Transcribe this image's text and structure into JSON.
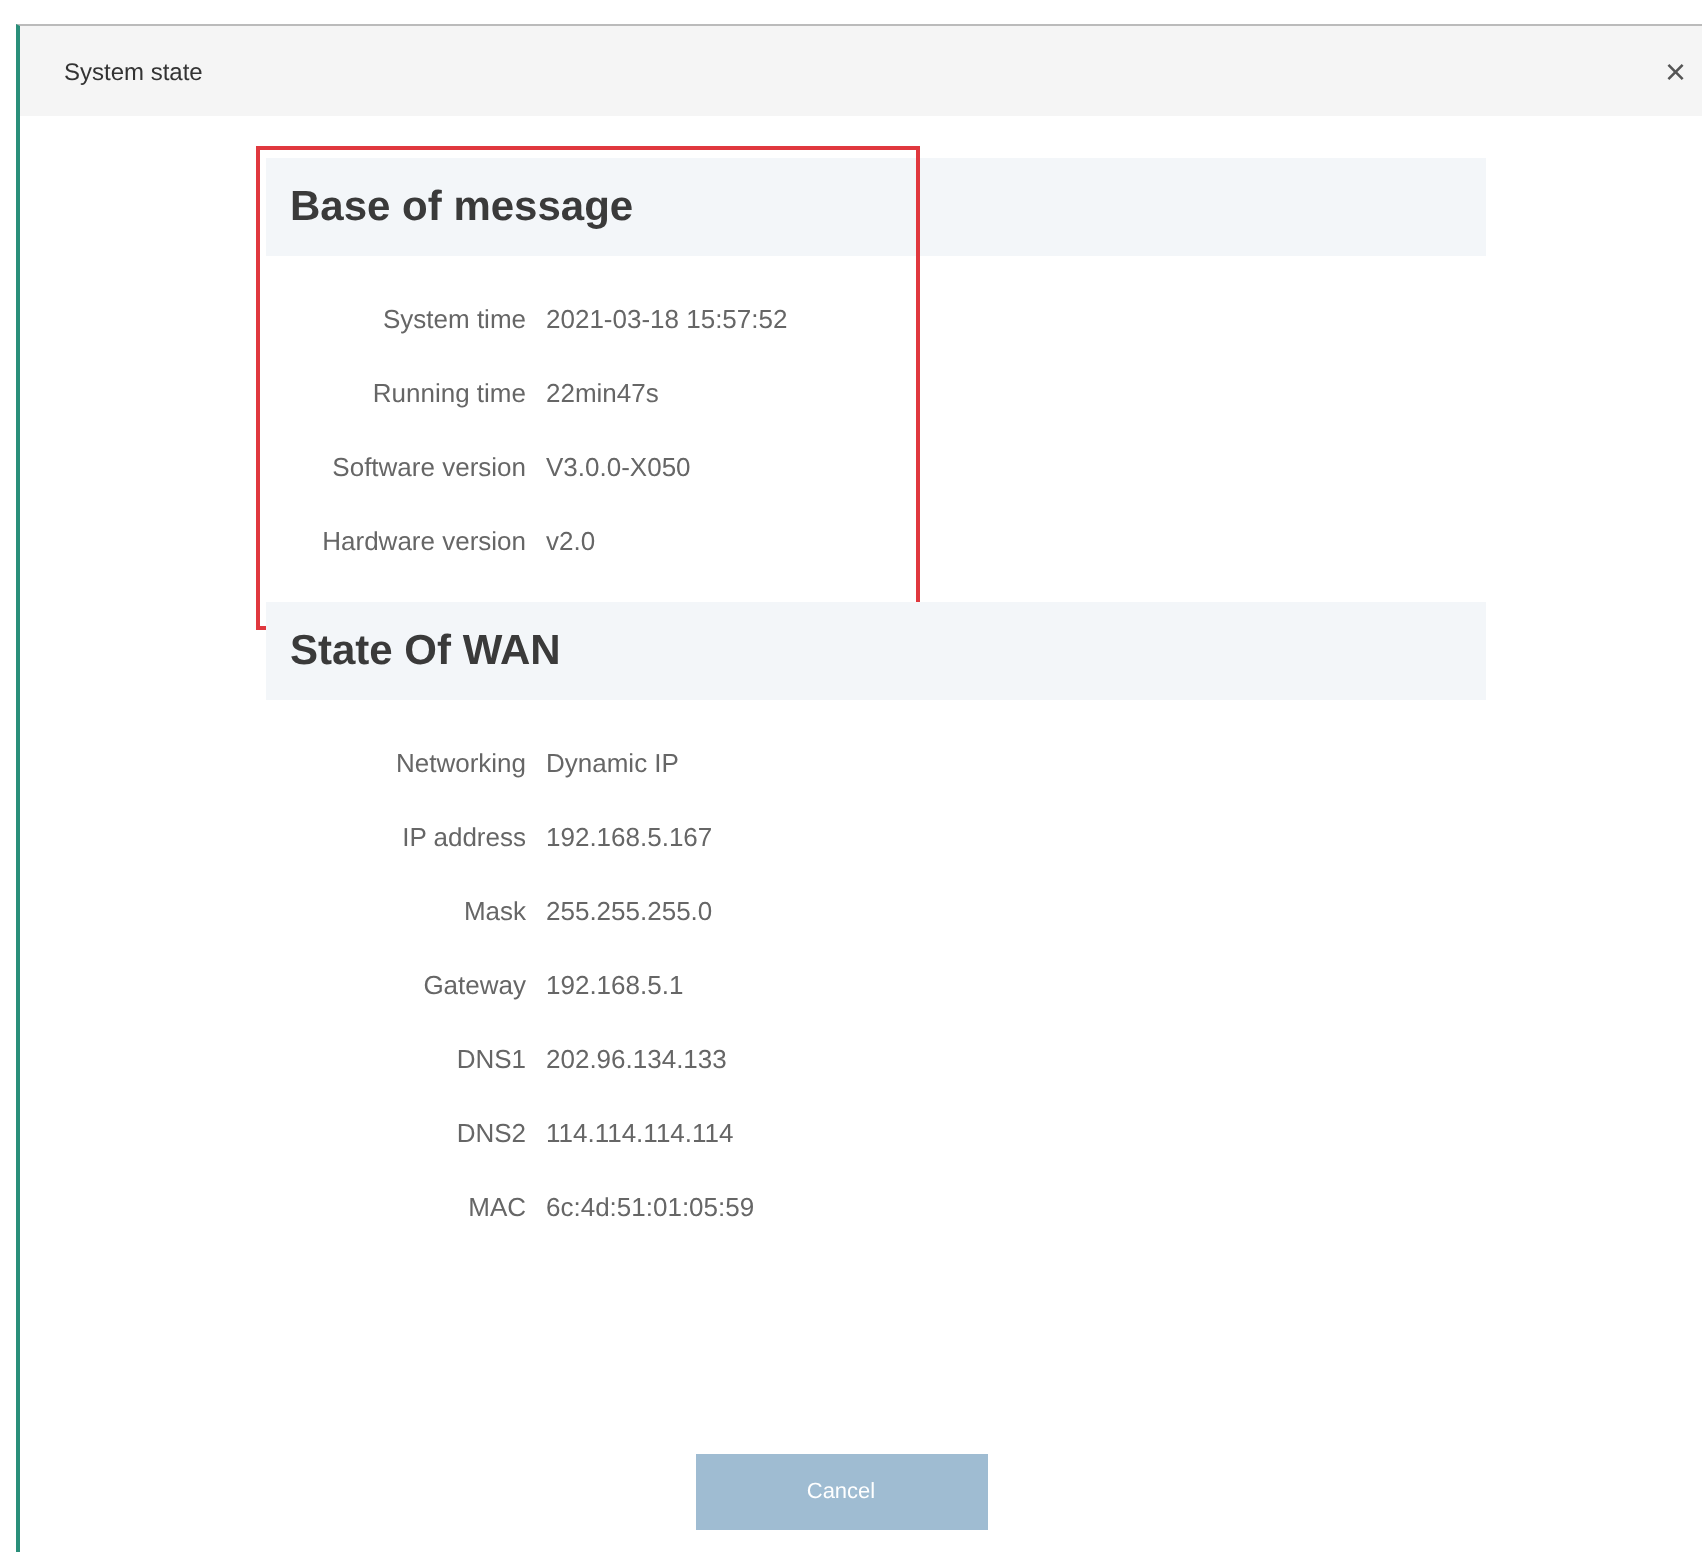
{
  "window": {
    "title": "System state",
    "close": "×"
  },
  "sections": [
    {
      "title": "Base of message",
      "highlighted": true,
      "rows": [
        {
          "label": "System time",
          "value": "2021-03-18 15:57:52"
        },
        {
          "label": "Running time",
          "value": "22min47s"
        },
        {
          "label": "Software version",
          "value": "V3.0.0-X050"
        },
        {
          "label": "Hardware version",
          "value": "v2.0"
        }
      ]
    },
    {
      "title": "State Of WAN",
      "highlighted": false,
      "rows": [
        {
          "label": "Networking",
          "value": "Dynamic IP"
        },
        {
          "label": "IP address",
          "value": "192.168.5.167"
        },
        {
          "label": "Mask",
          "value": "255.255.255.0"
        },
        {
          "label": "Gateway",
          "value": "192.168.5.1"
        },
        {
          "label": "DNS1",
          "value": "202.96.134.133"
        },
        {
          "label": "DNS2",
          "value": "114.114.114.114"
        },
        {
          "label": "MAC",
          "value": "6c:4d:51:01:05:59"
        }
      ]
    }
  ],
  "buttons": [
    {
      "label": "Cancel",
      "disabled": true
    }
  ]
}
